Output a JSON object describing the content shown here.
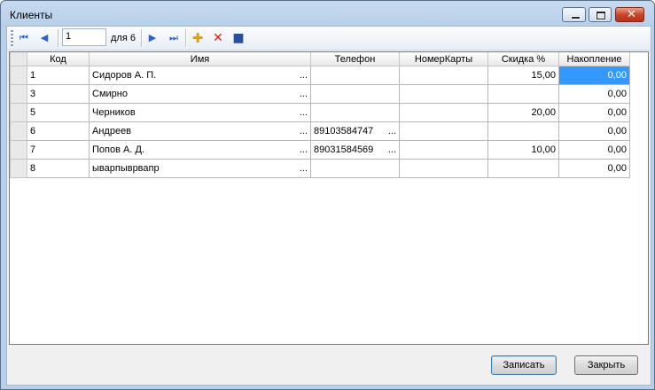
{
  "window": {
    "title": "Клиенты"
  },
  "navigator": {
    "first_icon": "first-record-icon",
    "prev_icon": "previous-record-icon",
    "position": "1",
    "count_label": "для 6",
    "next_icon": "next-record-icon",
    "last_icon": "last-record-icon",
    "add_icon": "add-icon",
    "delete_icon": "delete-icon",
    "save_icon": "save-icon"
  },
  "grid": {
    "columns": [
      "Код",
      "Имя",
      "Телефон",
      "НомерКарты",
      "Скидка %",
      "Накопление"
    ],
    "rows": [
      {
        "code": "1",
        "name": "Сидоров А. П.",
        "phone": "",
        "card": "",
        "discount": "15,00",
        "accum": "0,00"
      },
      {
        "code": "3",
        "name": "Смирно",
        "phone": "",
        "card": "",
        "discount": "",
        "accum": "0,00"
      },
      {
        "code": "5",
        "name": "Черников",
        "phone": "",
        "card": "",
        "discount": "20,00",
        "accum": "0,00"
      },
      {
        "code": "6",
        "name": "Андреев",
        "phone": "89103584747",
        "card": "",
        "discount": "",
        "accum": "0,00"
      },
      {
        "code": "7",
        "name": "Попов А. Д.",
        "phone": "89031584569",
        "card": "",
        "discount": "10,00",
        "accum": "0,00"
      },
      {
        "code": "8",
        "name": "ыварпыврвапр",
        "phone": "",
        "card": "",
        "discount": "",
        "accum": "0,00"
      }
    ],
    "ellipsis": "..."
  },
  "buttons": {
    "save": "Записать",
    "close": "Закрыть"
  },
  "colors": {
    "selection": "#3399ff",
    "accent": "#2a63c3"
  }
}
